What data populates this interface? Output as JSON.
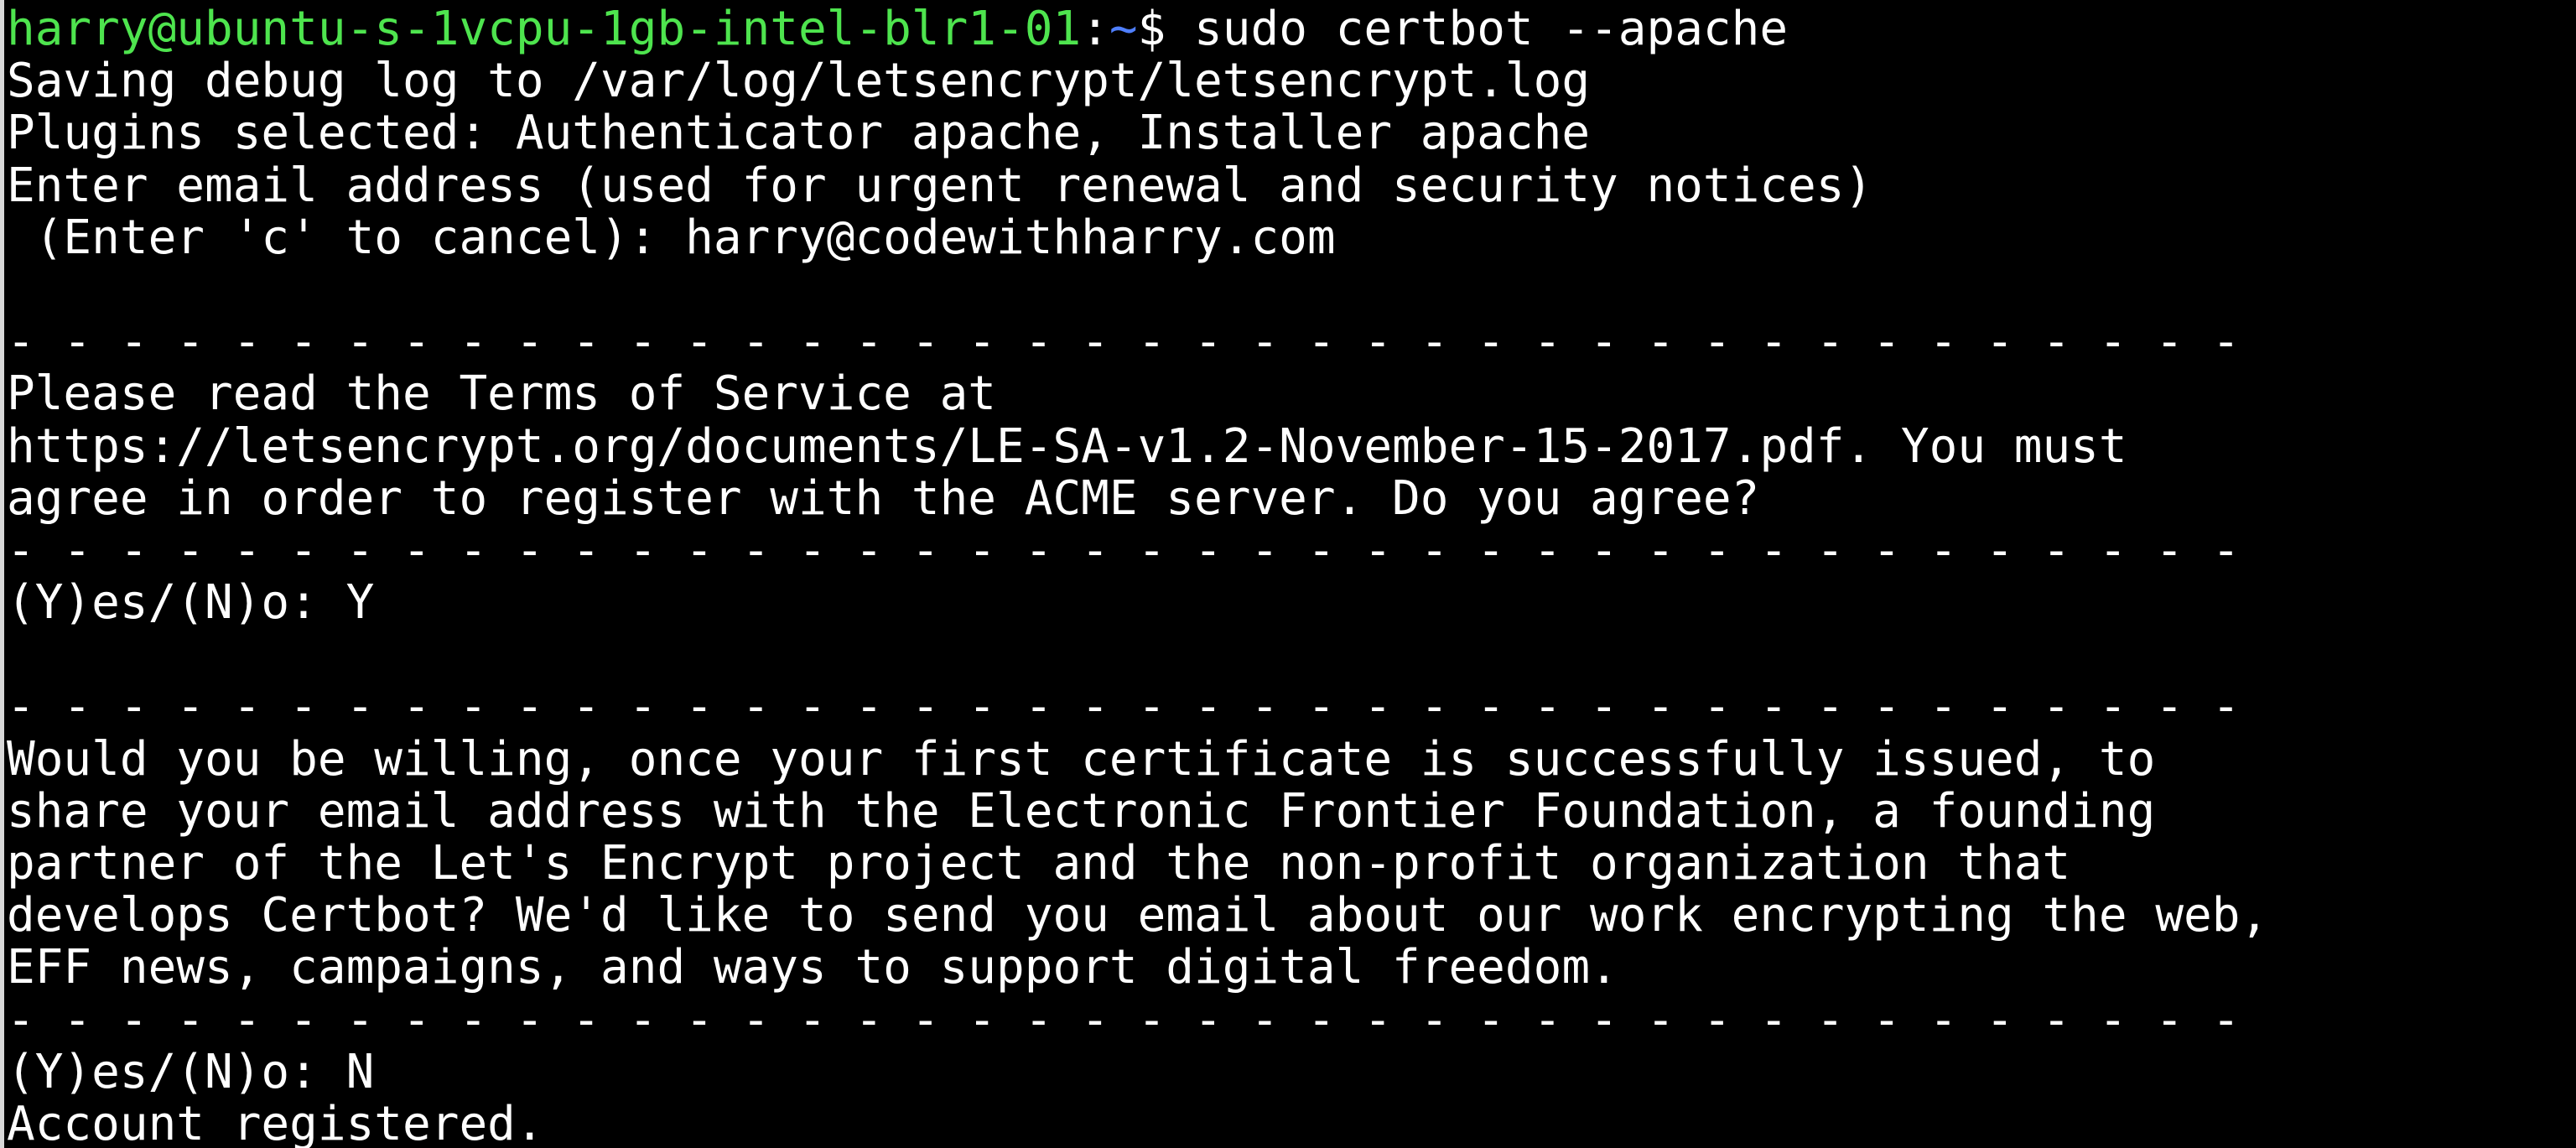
{
  "terminal": {
    "prompt": {
      "user_host": "harry@ubuntu-s-1vcpu-1gb-intel-blr1-01",
      "separator": ":",
      "path": "~",
      "symbol": "$",
      "command": " sudo certbot --apache"
    },
    "output_lines": [
      "Saving debug log to /var/log/letsencrypt/letsencrypt.log",
      "Plugins selected: Authenticator apache, Installer apache",
      "Enter email address (used for urgent renewal and security notices)",
      " (Enter 'c' to cancel): harry@codewithharry.com",
      "",
      "- - - - - - - - - - - - - - - - - - - - - - - - - - - - - - - - - - - - - - - -",
      "Please read the Terms of Service at",
      "https://letsencrypt.org/documents/LE-SA-v1.2-November-15-2017.pdf. You must",
      "agree in order to register with the ACME server. Do you agree?",
      "- - - - - - - - - - - - - - - - - - - - - - - - - - - - - - - - - - - - - - - -",
      "(Y)es/(N)o: Y",
      "",
      "- - - - - - - - - - - - - - - - - - - - - - - - - - - - - - - - - - - - - - - -",
      "Would you be willing, once your first certificate is successfully issued, to",
      "share your email address with the Electronic Frontier Foundation, a founding",
      "partner of the Let's Encrypt project and the non-profit organization that",
      "develops Certbot? We'd like to send you email about our work encrypting the web,",
      "EFF news, campaigns, and ways to support digital freedom.",
      "- - - - - - - - - - - - - - - - - - - - - - - - - - - - - - - - - - - - - - - -",
      "(Y)es/(N)o: N",
      "Account registered."
    ]
  },
  "colors": {
    "background": "#000000",
    "text": "#ffffff",
    "user_host": "#4ee44e",
    "path": "#4f7fff"
  }
}
